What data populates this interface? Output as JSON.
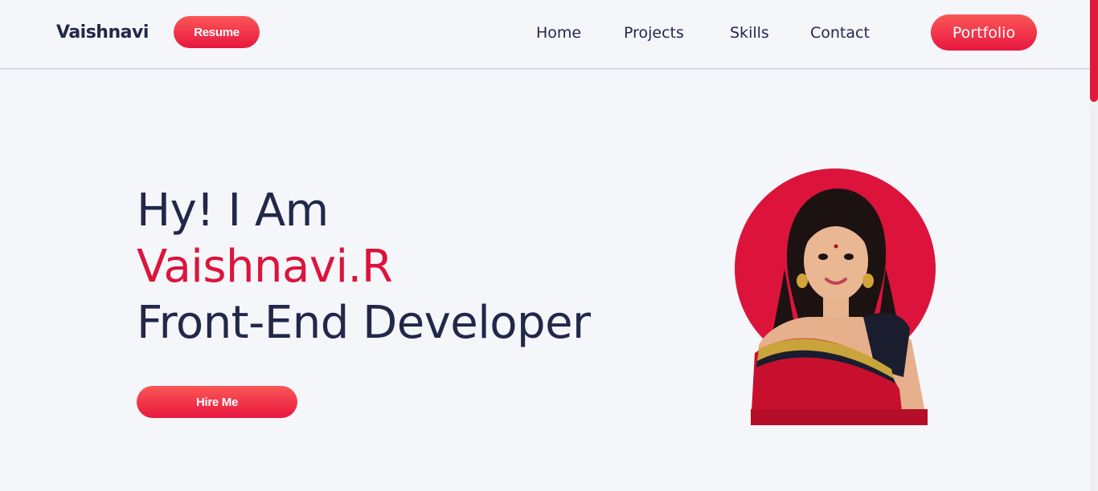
{
  "navbar": {
    "brand": "Vaishnavi",
    "resume_label": "Resume",
    "links": [
      {
        "label": "Home"
      },
      {
        "label": "Projects"
      },
      {
        "label": "Skills"
      },
      {
        "label": "Contact"
      }
    ],
    "portfolio_label": "Portfolio"
  },
  "hero": {
    "greeting": "Hy! I Am",
    "name": "Vaishnavi.R",
    "role": "Front-End Developer",
    "hire_label": "Hire Me"
  },
  "colors": {
    "accent": "#dc143c",
    "text": "#22284a",
    "background": "#f5f6fa",
    "button_gradient_top": "#fb5757",
    "button_gradient_bottom": "#e8173f"
  },
  "icons": {
    "avatar": "profile-photo"
  }
}
